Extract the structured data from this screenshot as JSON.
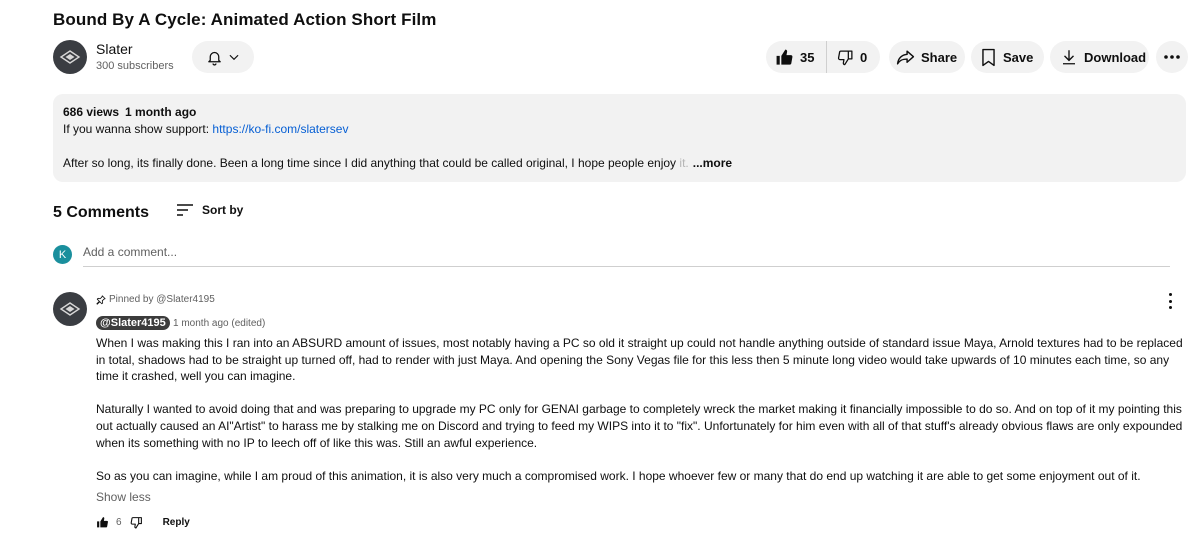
{
  "video": {
    "title": "Bound By A Cycle: Animated Action Short Film"
  },
  "channel": {
    "name": "Slater",
    "subscribers": "300 subscribers"
  },
  "actions": {
    "likes": "35",
    "dislikes": "0",
    "share": "Share",
    "save": "Save",
    "download": "Download"
  },
  "description": {
    "views": "686 views",
    "date": "1 month ago",
    "support_prefix": "If you wanna show support: ",
    "support_link": "https://ko-fi.com/slatersev",
    "text_main": "After so long, its finally done. Been a long time since I did anything that could be called original, I hope people enjoy ",
    "text_faded": "it.",
    "more": "...more"
  },
  "comments": {
    "count": "5 Comments",
    "sort_label": "Sort by",
    "user_initial": "K",
    "add_placeholder": "Add a comment...",
    "pinned": {
      "pinned_label": "Pinned by @Slater4195",
      "author": "@Slater4195",
      "time": "1 month ago (edited)",
      "paragraph_1": "When I was making this I ran into an ABSURD amount of issues, most notably having a PC so old it straight up could not handle anything outside of standard issue Maya, Arnold textures had to be replaced in total, shadows had to be straight up turned off, had to render with just Maya. And opening the Sony Vegas file for this less then 5 minute long video would take upwards of 10 minutes each time, so any time it crashed, well you can imagine.",
      "paragraph_2": "Naturally I wanted to avoid doing that and was preparing to upgrade my PC only for GENAI garbage to completely wreck the market making it financially impossible to do so. And on top of it my pointing this out actually caused an AI\"Artist\" to harass me by stalking me on Discord and trying to feed my WIPS into it to \"fix\". Unfortunately for him even with all of that stuff's already obvious flaws are only expounded when its something with no IP to leech off of like this was. Still an awful experience.",
      "paragraph_3": "So as you can imagine, while I am proud of this animation, it is also very much a compromised work. I hope whoever few or many that do end up watching it are able to get some enjoyment out of it.",
      "show_less": "Show less",
      "likes": "6",
      "reply": "Reply"
    }
  },
  "colors": {
    "link": "#065fd4",
    "pill_bg": "#f2f2f2",
    "avatar_k": "#1a8f9d",
    "author_chip": "#3c3c3c"
  },
  "icons": [
    "channel-logo-icon",
    "bell-icon",
    "chevron-down-icon",
    "thumb-up-icon",
    "thumb-down-icon",
    "share-icon",
    "bookmark-icon",
    "download-icon",
    "more-horizontal-icon",
    "sort-icon",
    "pin-icon",
    "more-vertical-icon"
  ]
}
